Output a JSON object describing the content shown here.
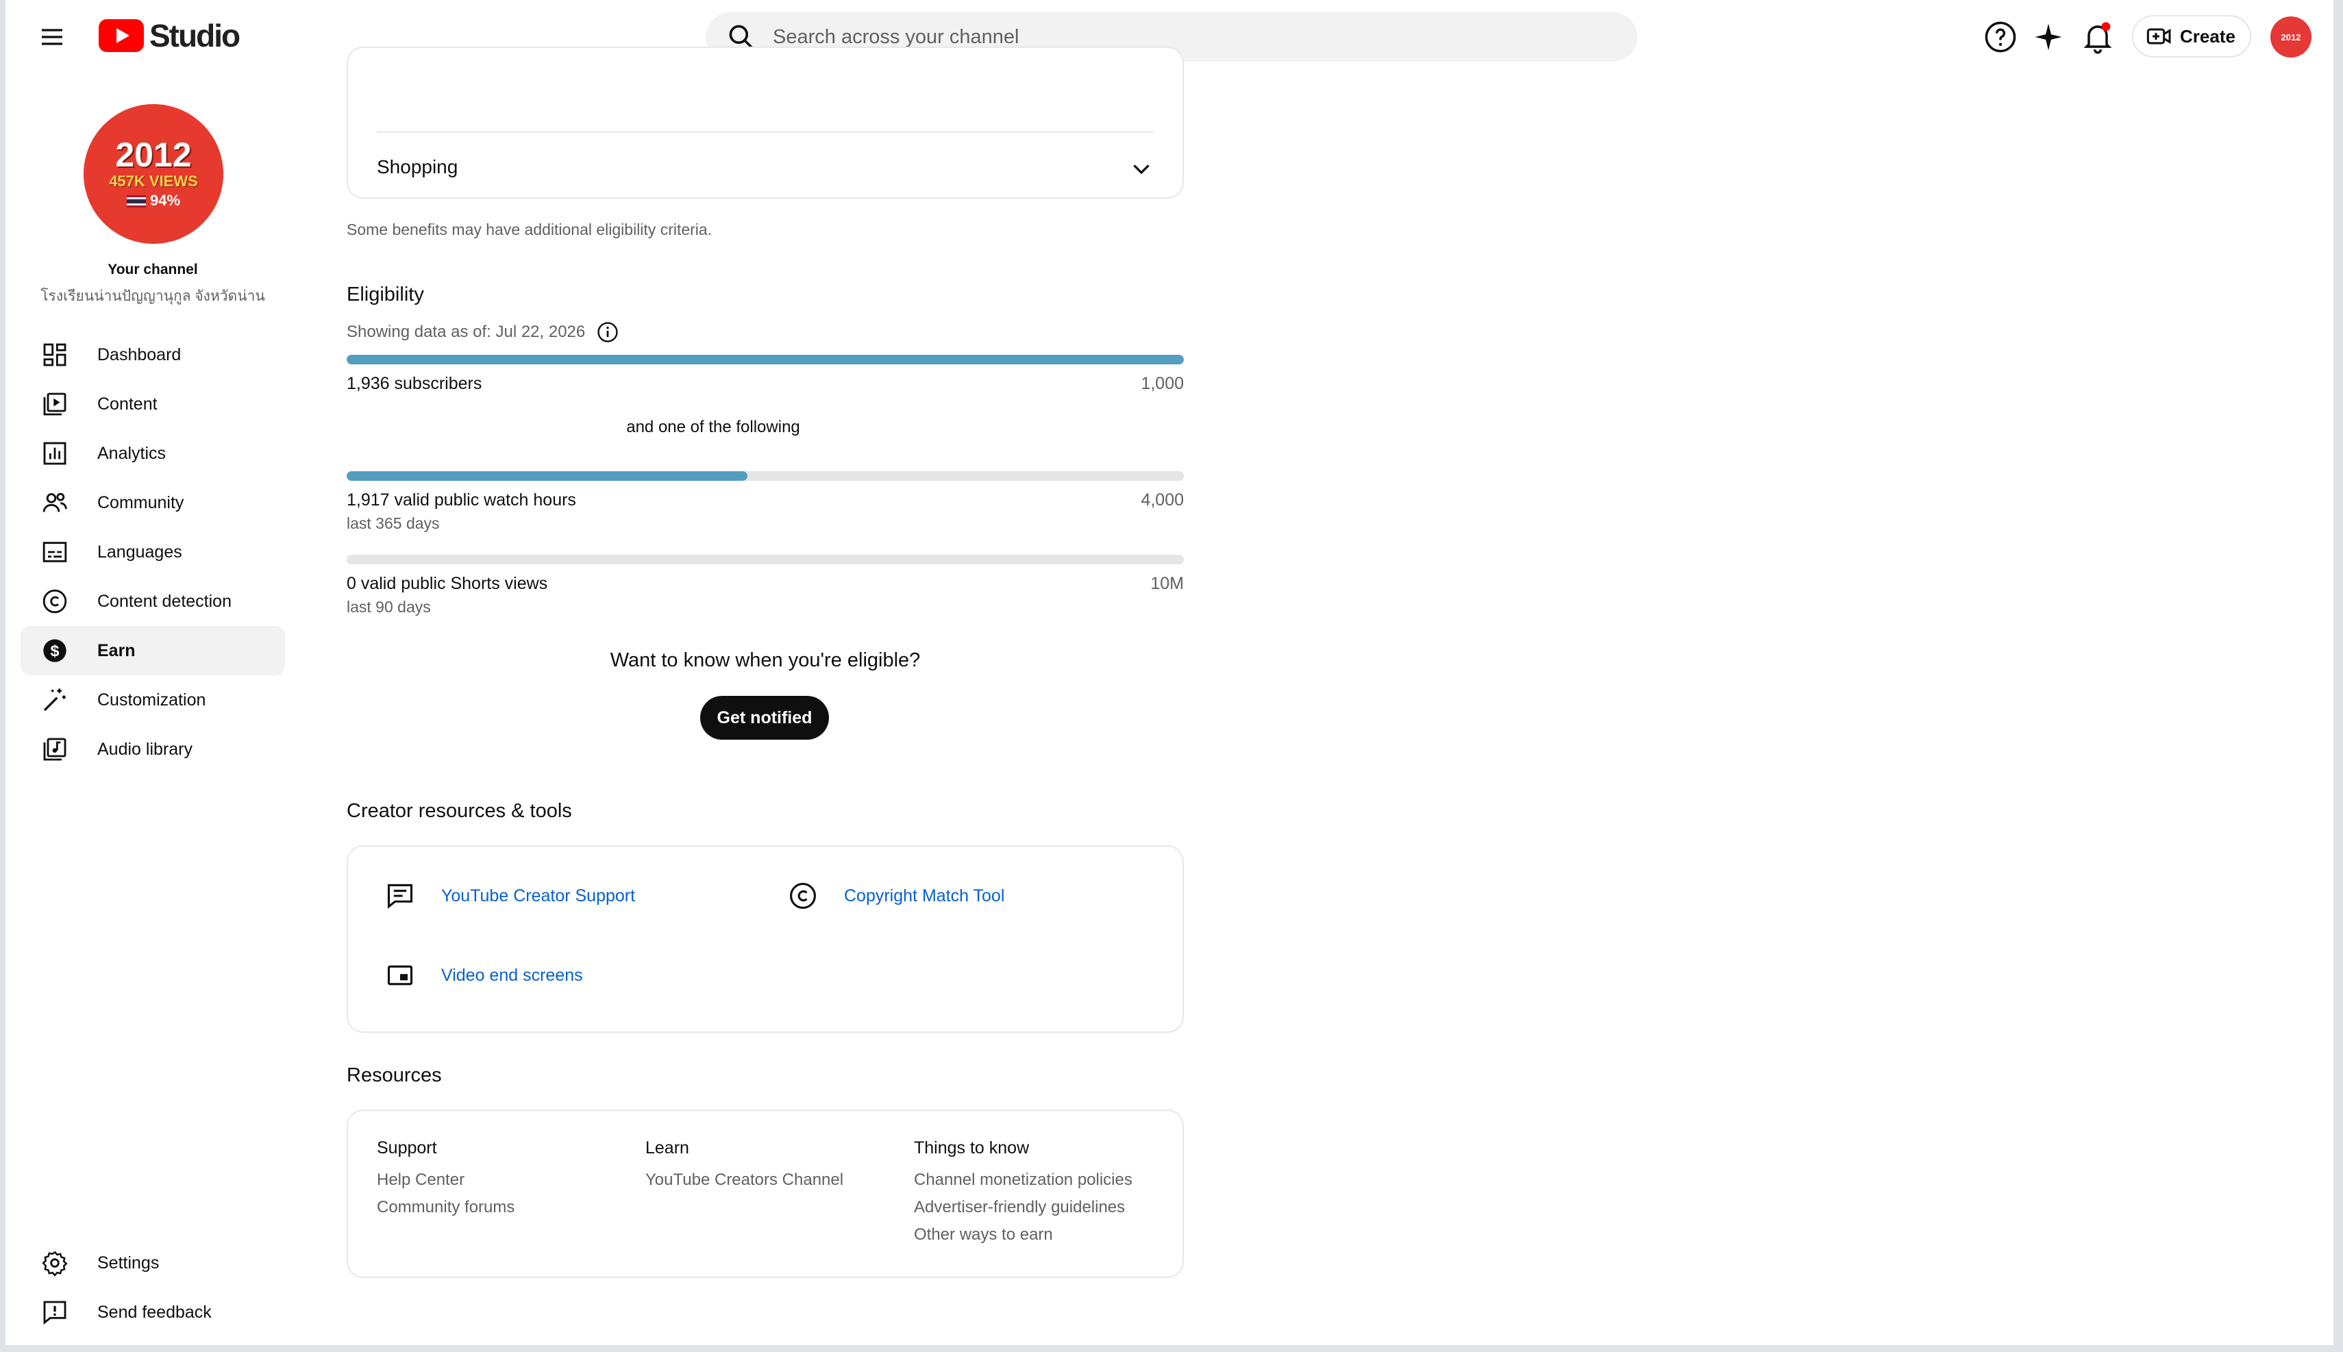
{
  "header": {
    "app_name": "Studio",
    "search_placeholder": "Search across your channel",
    "create_label": "Create",
    "avatar_text": "2012"
  },
  "sidebar": {
    "avatar": {
      "line1": "2012",
      "line2": "457K VIEWS",
      "line3": "94%"
    },
    "your_channel": "Your channel",
    "channel_name": "โรงเรียนน่านปัญญานุกูล จังหวัดน่าน",
    "items": [
      {
        "label": "Dashboard",
        "icon": "dashboard-icon"
      },
      {
        "label": "Content",
        "icon": "content-icon"
      },
      {
        "label": "Analytics",
        "icon": "analytics-icon"
      },
      {
        "label": "Community",
        "icon": "community-icon"
      },
      {
        "label": "Languages",
        "icon": "languages-icon"
      },
      {
        "label": "Content detection",
        "icon": "copyright-icon"
      },
      {
        "label": "Earn",
        "icon": "dollar-icon",
        "active": true
      },
      {
        "label": "Customization",
        "icon": "magic-wand-icon"
      },
      {
        "label": "Audio library",
        "icon": "audio-library-icon"
      }
    ],
    "bottom_items": [
      {
        "label": "Settings",
        "icon": "gear-icon"
      },
      {
        "label": "Send feedback",
        "icon": "feedback-icon"
      }
    ]
  },
  "main": {
    "shopping_label": "Shopping",
    "benefits_note": "Some benefits may have additional eligibility criteria.",
    "eligibility": {
      "title": "Eligibility",
      "as_of": "Showing data as of: Jul 22, 2026",
      "subscribers": {
        "label": "1,936 subscribers",
        "target": "1,000",
        "progress": 1.0
      },
      "and_one": "and one of the following",
      "watch_hours": {
        "label": "1,917 valid public watch hours",
        "sub": "last 365 days",
        "target": "4,000",
        "progress": 0.479
      },
      "shorts_views": {
        "label": "0 valid public Shorts views",
        "sub": "last 90 days",
        "target": "10M",
        "progress": 0.0
      },
      "want_to_know": "Want to know when you're eligible?",
      "notify_label": "Get notified"
    },
    "creator_tools": {
      "title": "Creator resources & tools",
      "items": [
        {
          "label": "YouTube Creator Support",
          "icon": "chat-icon"
        },
        {
          "label": "Copyright Match Tool",
          "icon": "copyright-icon"
        },
        {
          "label": "Video end screens",
          "icon": "end-screen-icon"
        }
      ]
    },
    "resources": {
      "title": "Resources",
      "columns": [
        {
          "heading": "Support",
          "links": [
            "Help Center",
            "Community forums"
          ]
        },
        {
          "heading": "Learn",
          "links": [
            "YouTube Creators Channel"
          ]
        },
        {
          "heading": "Things to know",
          "links": [
            "Channel monetization policies",
            "Advertiser-friendly guidelines",
            "Other ways to earn"
          ]
        }
      ]
    }
  },
  "colors": {
    "progress": "#539dbf",
    "link": "#065fd4",
    "brand": "#ff0000",
    "notification_dot": "#ff0000"
  }
}
